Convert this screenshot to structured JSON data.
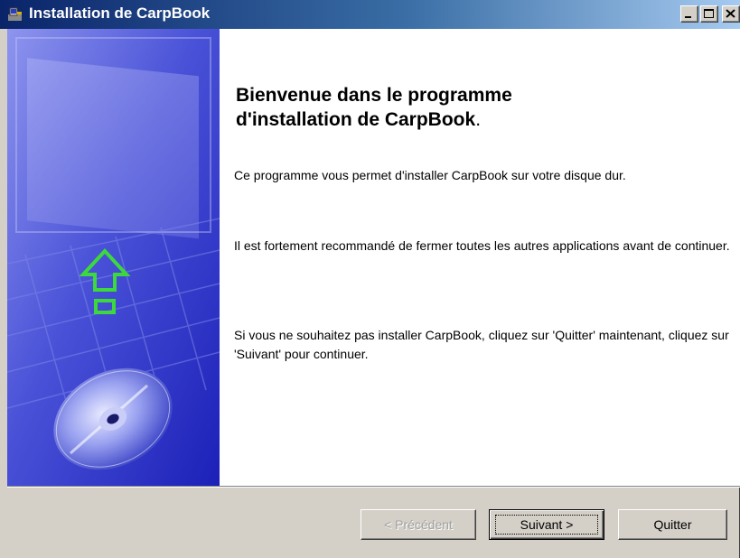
{
  "window": {
    "title": "Installation de CarpBook",
    "icon": "installer-app-icon",
    "controls": [
      "minimize-icon",
      "maximize-icon",
      "close-icon"
    ]
  },
  "welcome": {
    "heading_line1": "Bienvenue dans le programme",
    "heading_line2": "d'installation de CarpBook",
    "heading_end": ".",
    "paragraph1": "Ce programme vous permet d'installer CarpBook sur votre disque dur.",
    "paragraph2": "Il est fortement recommandé de fermer toutes les autres applications avant de continuer.",
    "paragraph3": "Si vous ne souhaitez pas installer CarpBook, cliquez sur 'Quitter' maintenant, cliquez sur 'Suivant' pour continuer."
  },
  "buttons": {
    "previous": "< Précédent",
    "next": "Suivant >",
    "quit": "Quitter"
  },
  "colors": {
    "titlebar_start": "#0a246a",
    "titlebar_end": "#a6caf0",
    "side_panel": "#2a2ec8",
    "arrow_green": "#3cd83c"
  }
}
